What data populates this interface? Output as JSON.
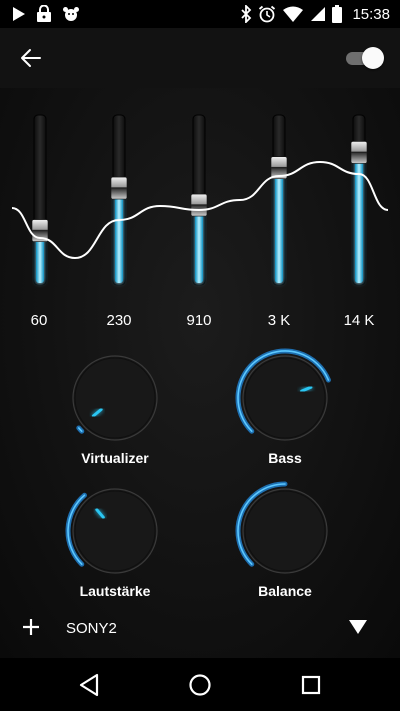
{
  "status_bar": {
    "time": "15:38",
    "left_icons": [
      "play-icon",
      "lock-icon",
      "pet-icon"
    ],
    "right_icons": [
      "bluetooth-icon",
      "alarm-icon",
      "wifi-icon",
      "signal-icon",
      "battery-icon"
    ]
  },
  "app_bar": {
    "back_icon": "arrow-left-icon",
    "toggle_state": "on"
  },
  "equalizer": {
    "bands": [
      {
        "label": "60",
        "level": 0.32
      },
      {
        "label": "230",
        "level": 0.57
      },
      {
        "label": "910",
        "level": 0.47
      },
      {
        "label": "3 K",
        "level": 0.69
      },
      {
        "label": "14 K",
        "level": 0.78
      }
    ],
    "accent_color": "#29c6f2",
    "curve_color": "#ffffff"
  },
  "knobs": [
    {
      "label": "Virtualizer",
      "value": 0.02
    },
    {
      "label": "Bass",
      "value": 0.75
    },
    {
      "label": "Lautstärke",
      "value": 0.35
    },
    {
      "label": "Balance",
      "value": 0.5
    }
  ],
  "preset": {
    "name": "SONY2",
    "add_icon": "plus-icon",
    "dropdown_icon": "triangle-down-icon"
  },
  "nav_bar": {
    "icons": [
      "back-triangle-icon",
      "home-circle-icon",
      "recents-square-icon"
    ]
  }
}
